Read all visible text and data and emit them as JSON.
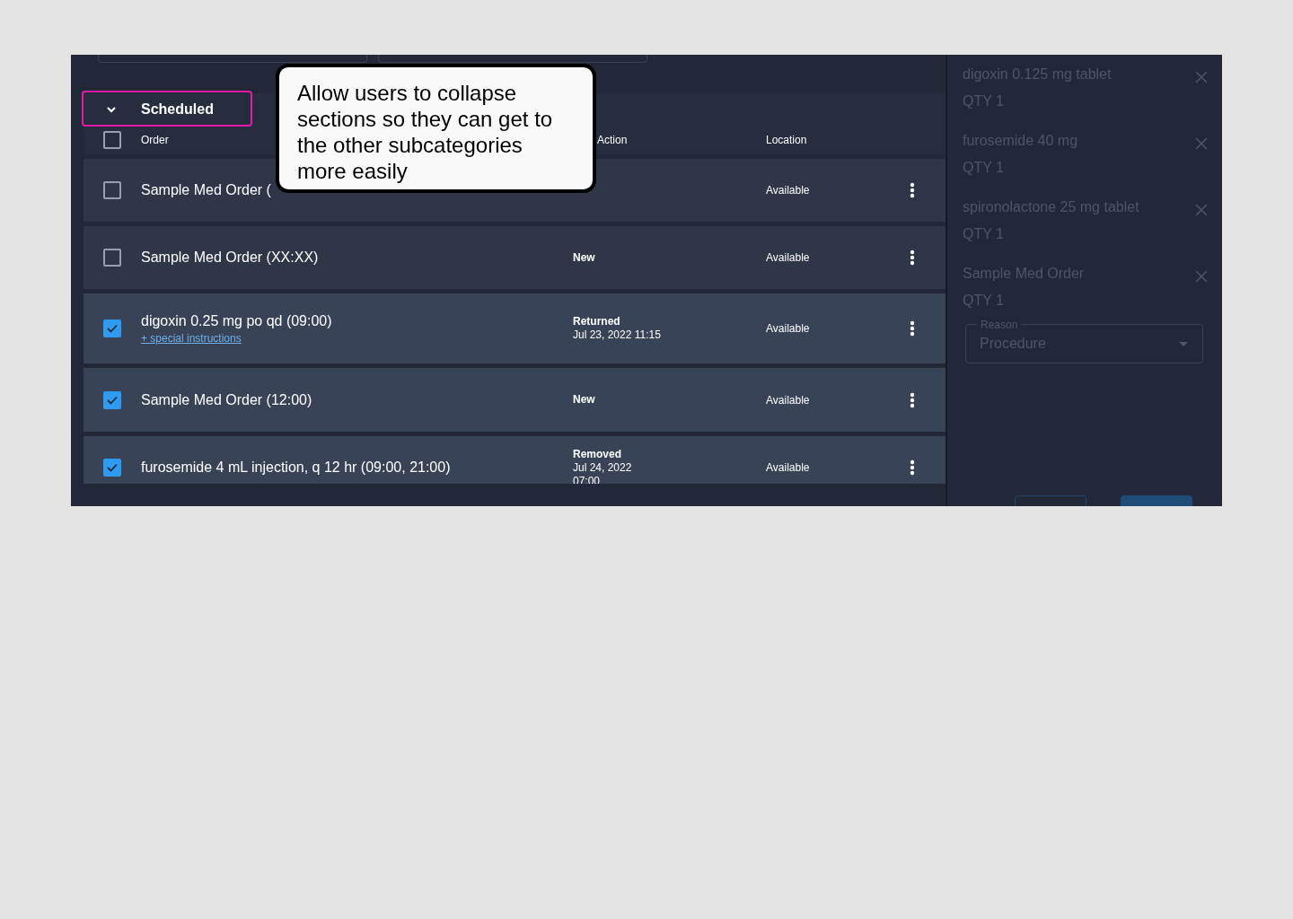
{
  "section": {
    "title": "Scheduled",
    "expanded": true,
    "select_all_checked": false
  },
  "columns": [
    "Order",
    "Action",
    "Location"
  ],
  "rows": [
    {
      "order": "Sample Med Order (",
      "checked": false,
      "location": "Available"
    },
    {
      "order": "Sample Med Order (XX:XX)",
      "checked": false,
      "action": "New",
      "location": "Available"
    },
    {
      "order": "digoxin 0.25 mg po qd (09:00)",
      "note": "+ special instructions",
      "checked": true,
      "action": "Returned",
      "action_detail": [
        "Jul 23, 2022 11:15"
      ],
      "location": "Available"
    },
    {
      "order": "Sample Med Order (12:00)",
      "checked": true,
      "action": "New",
      "location": "Available"
    },
    {
      "order": "furosemide 4 mL injection, q 12 hr (09:00, 21:00)",
      "checked": true,
      "action": "Removed",
      "action_detail": [
        "Jul 24, 2022",
        "07:00"
      ],
      "location": "Available"
    }
  ],
  "side_panel": {
    "items": [
      {
        "name": "digoxin 0.125 mg tablet",
        "qty": "QTY 1"
      },
      {
        "name": "furosemide 40 mg",
        "qty": "QTY 1"
      },
      {
        "name": "spironolactone 25 mg tablet",
        "qty": "QTY 1"
      },
      {
        "name": "Sample Med Order",
        "qty": "QTY 1"
      }
    ],
    "reason": {
      "label": "Reason",
      "value": "Procedure"
    }
  },
  "annotation": {
    "text": "Allow users to collapse sections so they can get to the other subcategories more easily"
  }
}
